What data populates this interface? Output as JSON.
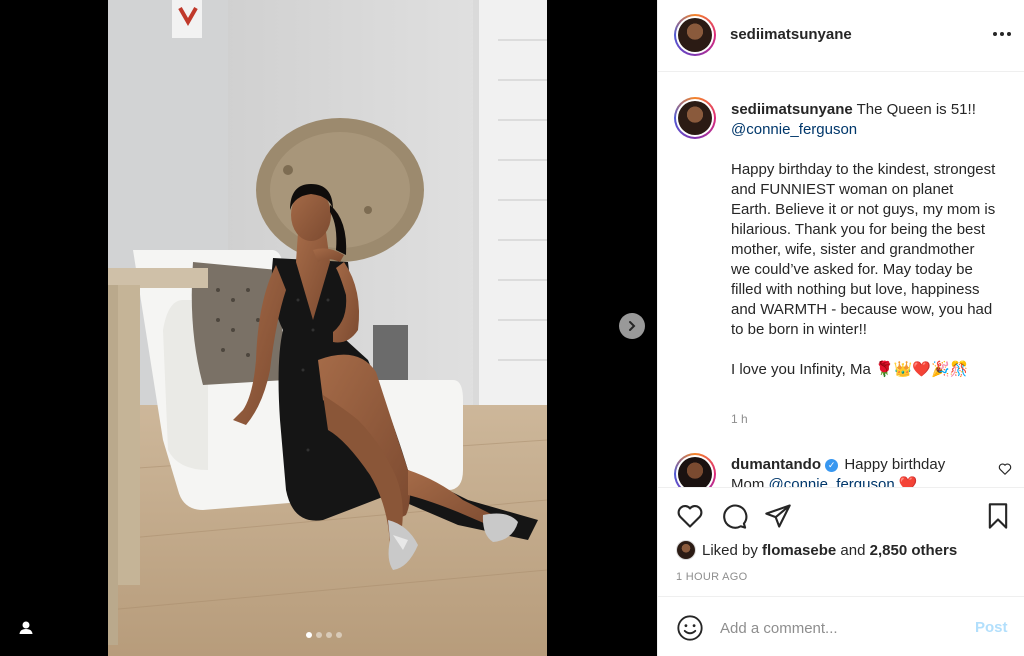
{
  "post": {
    "username": "sediimatsunyane",
    "caption": {
      "username": "sediimatsunyane",
      "line1": "The Queen is 51!!",
      "mention": "@connie_ferguson",
      "para2": "Happy birthday to the kindest, strongest and FUNNIEST woman on planet Earth. Believe it or not guys, my mom is hilarious. Thank you for being the best mother, wife, sister and grandmother we could’ve asked for. May today be filled with nothing but love, happiness and WARMTH - because wow, you had to be born in winter!!",
      "para3": "I love you Infinity, Ma 🌹👑❤️🎉🎊",
      "time": "1 h"
    },
    "comments": [
      {
        "username": "dumantando",
        "verified": true,
        "text": "Happy birthday",
        "line2_prefix": "Mom",
        "mention": "@connie_ferguson",
        "emoji": "❤️"
      }
    ],
    "likes": {
      "prefix": "Liked by",
      "liker": "flomasebe",
      "joiner": "and",
      "others": "2,850 others"
    },
    "time_ago": "1 HOUR AGO",
    "comment_box": {
      "placeholder": "Add a comment...",
      "post_label": "Post"
    },
    "carousel": {
      "count": 4,
      "active_index": 0
    }
  },
  "icons": {
    "more": "more-options-icon",
    "like": "heart-icon",
    "comment": "comment-icon",
    "share": "paper-plane-icon",
    "save": "bookmark-icon",
    "emoji": "emoji-icon",
    "next": "chevron-right-icon",
    "tag": "user-tag-icon"
  },
  "colors": {
    "link": "#00376b",
    "muted": "#8e8e8e",
    "post_disabled": "#b2dffc",
    "verified": "#3897f0"
  }
}
